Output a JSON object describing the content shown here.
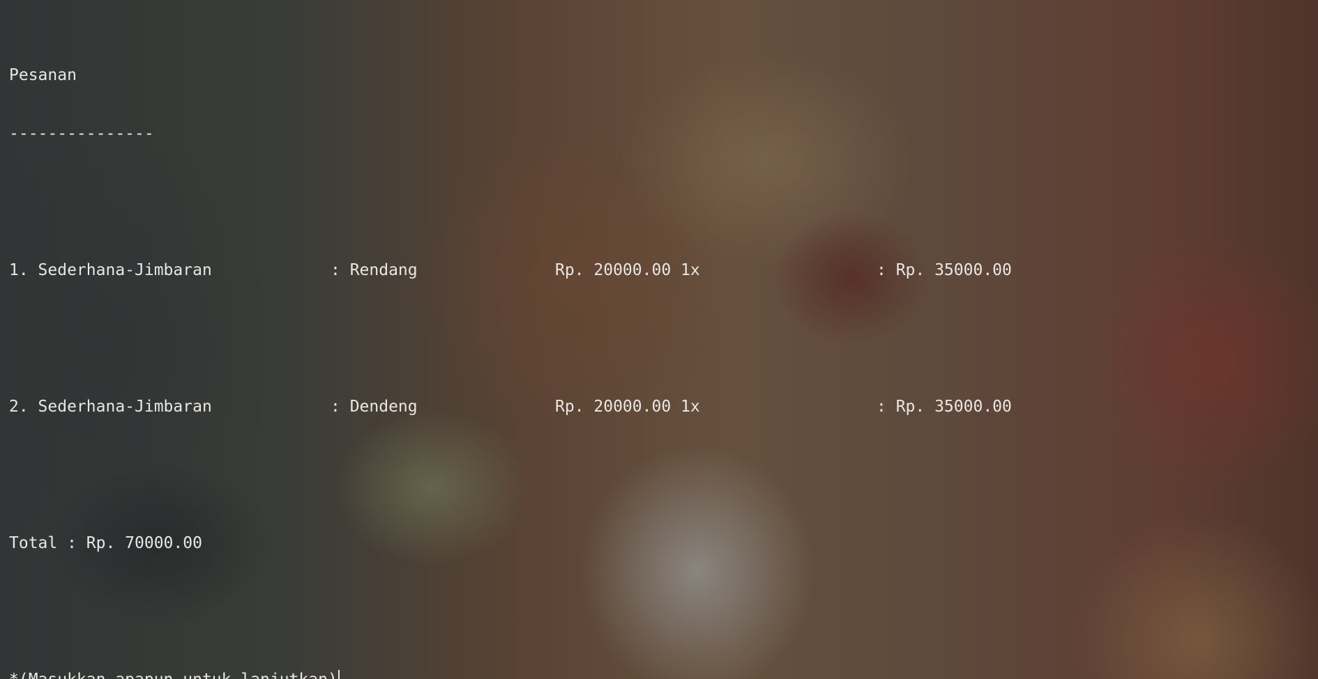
{
  "terminal": {
    "heading": "Pesanan",
    "divider": "---------------",
    "orders": [
      {
        "store": "1. Sederhana-Jimbaran",
        "menu": ": Rendang",
        "price": "Rp. 20000.00 1x",
        "subtotal": ": Rp. 35000.00"
      },
      {
        "store": "2. Sederhana-Jimbaran",
        "menu": ": Dendeng",
        "price": "Rp. 20000.00 1x",
        "subtotal": ": Rp. 35000.00"
      }
    ],
    "total": "Total : Rp. 70000.00",
    "prompt": "*(Masukkan apapun untuk lanjutkan)"
  }
}
